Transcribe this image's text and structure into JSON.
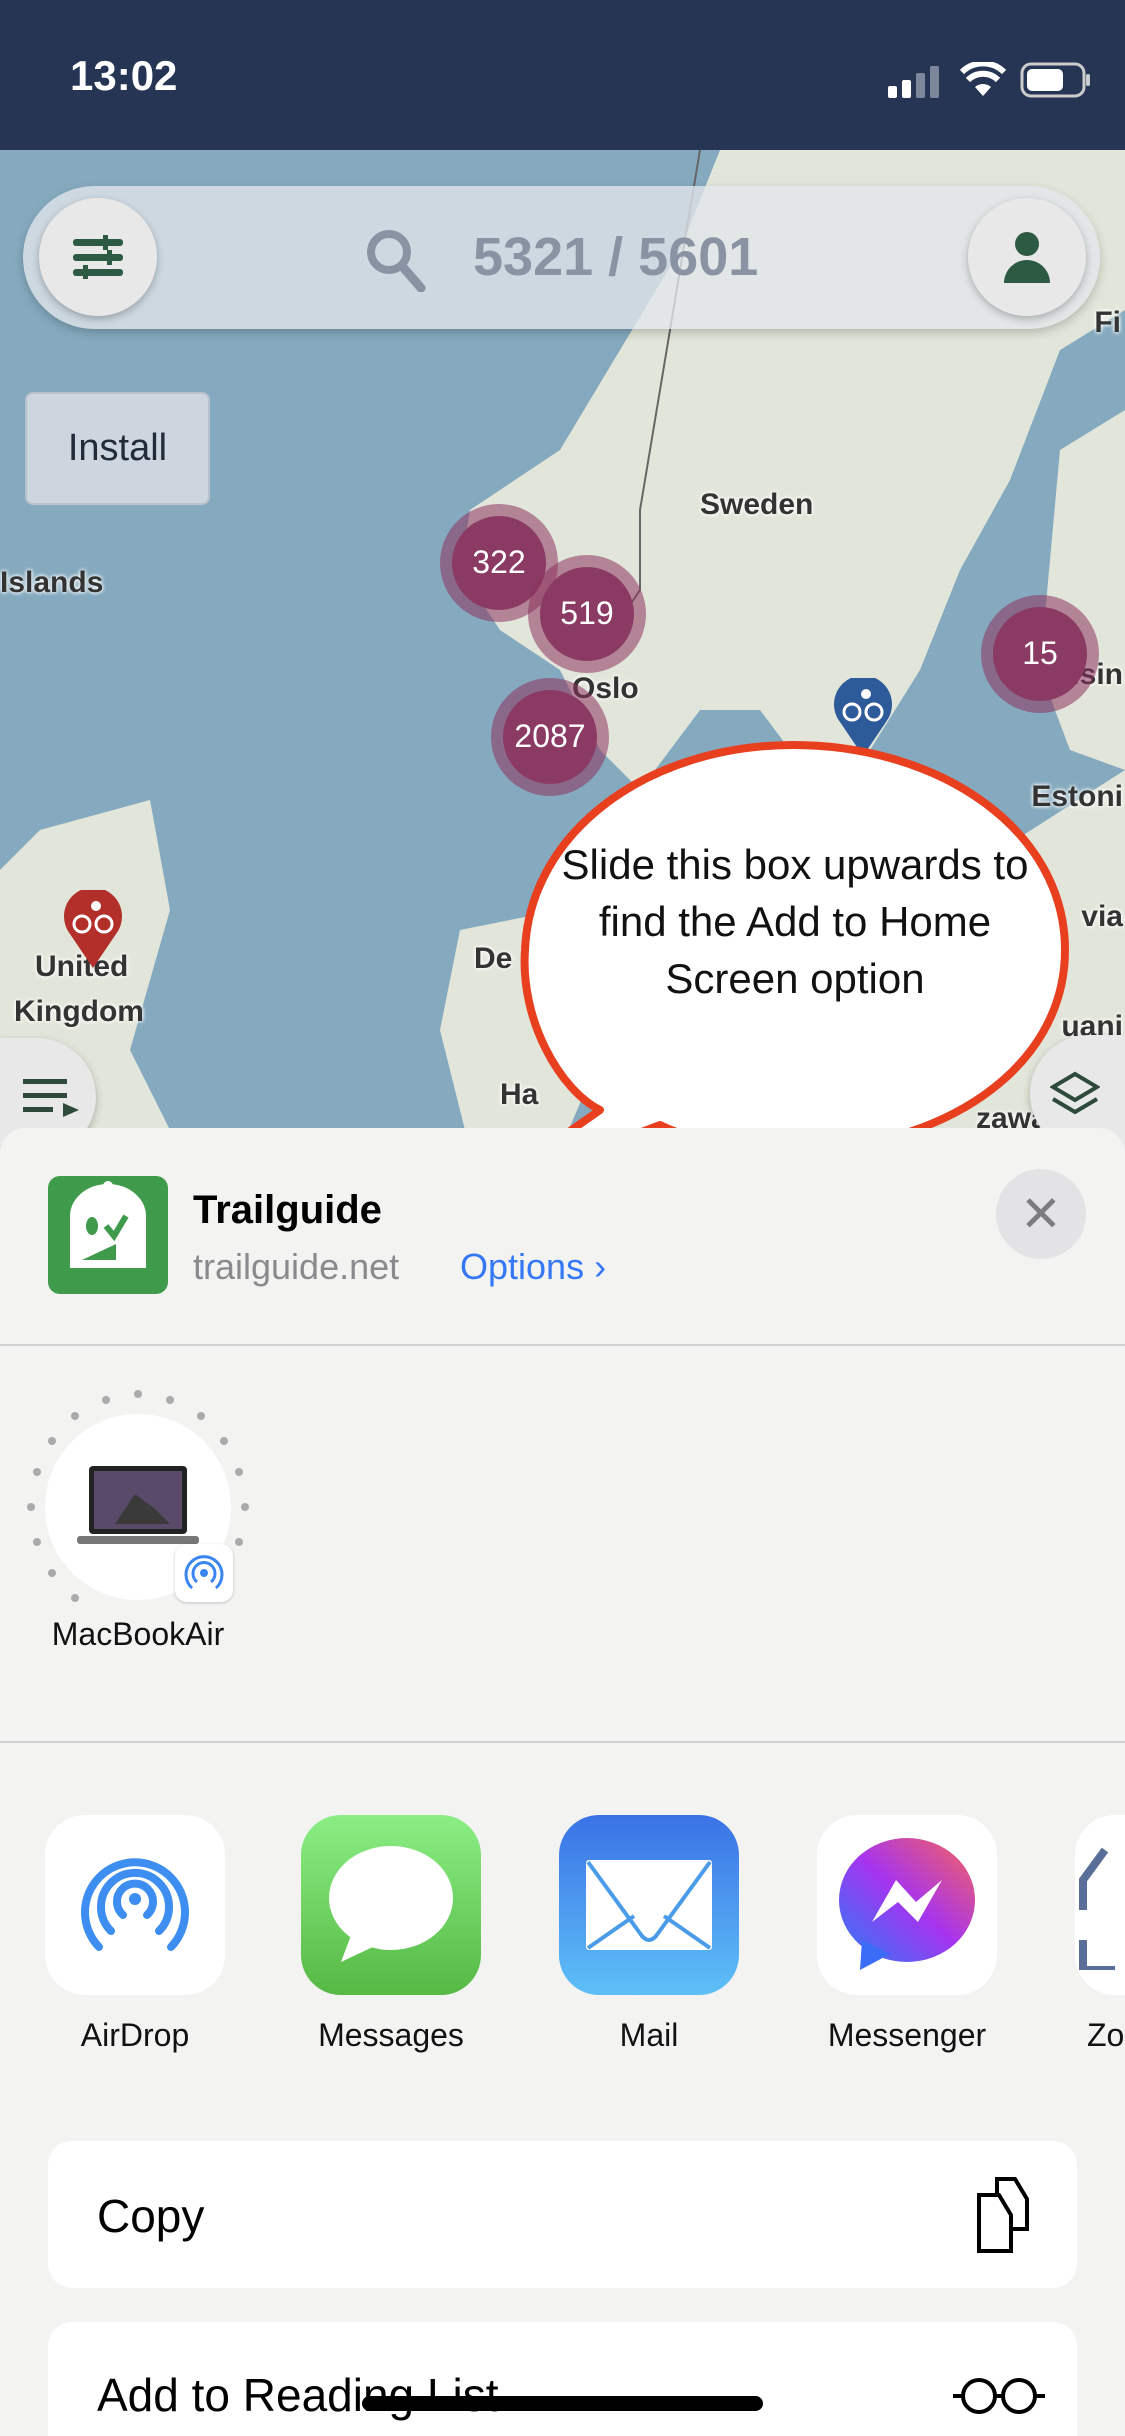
{
  "status_bar": {
    "time": "13:02"
  },
  "map": {
    "search_count": "5321 / 5601",
    "install_label": "Install",
    "labels": [
      "Sweden",
      "Islands",
      "Oslo",
      "Helsin",
      "Estoni",
      "United",
      "Kingdom",
      "De",
      "Ha",
      "Fi",
      "via",
      "uani",
      "zawa"
    ],
    "clusters": [
      "322",
      "519",
      "2087",
      "15"
    ]
  },
  "callout": {
    "text": "Slide this box upwards to find the Add to Home Screen option"
  },
  "share_sheet": {
    "title": "Trailguide",
    "url": "trailguide.net",
    "options_label": "Options ›",
    "close_label": "✕",
    "device": {
      "name": "MacBookAir"
    },
    "apps": [
      {
        "label": "AirDrop"
      },
      {
        "label": "Messages"
      },
      {
        "label": "Mail"
      },
      {
        "label": "Messenger"
      },
      {
        "label": "Zo"
      }
    ],
    "actions": [
      {
        "label": "Copy",
        "icon": "copy-icon"
      },
      {
        "label": "Add to Reading List",
        "icon": "glasses-icon"
      }
    ]
  },
  "colors": {
    "status_bar": "#263553",
    "cluster": "#8b3a63",
    "accent": "#3478f6",
    "app_green": "#3f9a4c",
    "callout_border": "#e8401f"
  }
}
